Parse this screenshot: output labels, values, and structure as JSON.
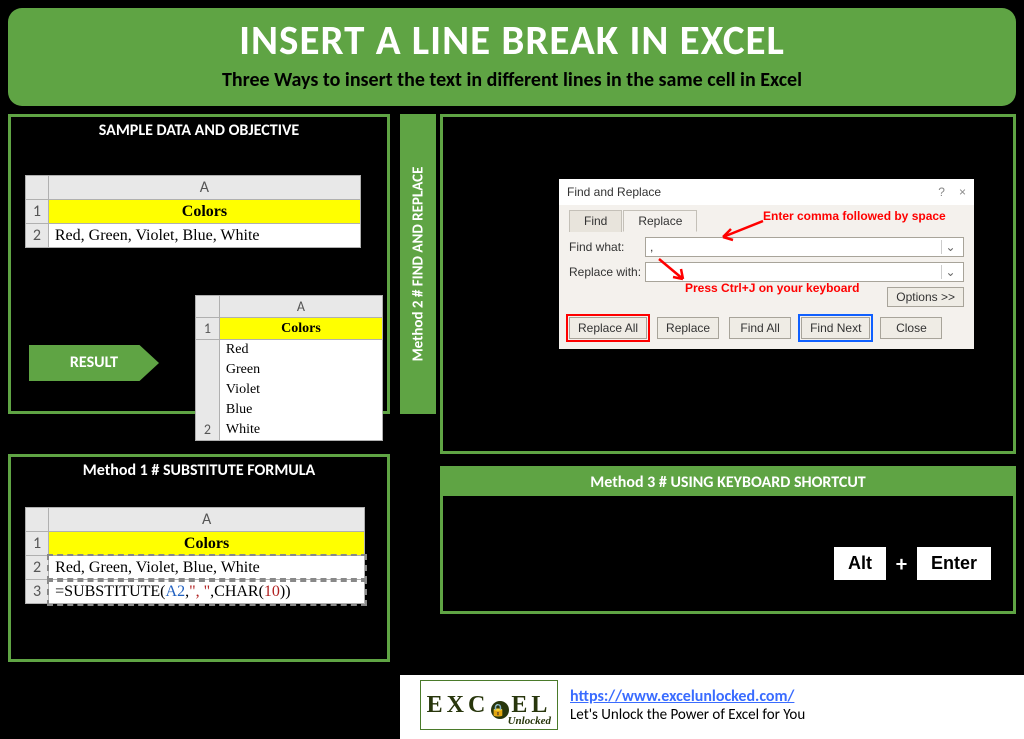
{
  "header": {
    "title": "INSERT A LINE BREAK IN EXCEL",
    "subtitle": "Three Ways to insert the text in different lines in the same cell in Excel"
  },
  "sample": {
    "title": "SAMPLE DATA AND OBJECTIVE",
    "grid1_colA": "A",
    "grid1_r1": "1",
    "grid1_r2": "2",
    "grid1_header": "Colors",
    "grid1_value": "Red, Green, Violet, Blue, White",
    "result_label": "RESULT",
    "grid2_colA": "A",
    "grid2_r1": "1",
    "grid2_r2": "2",
    "grid2_header": "Colors",
    "grid2_l1": "Red",
    "grid2_l2": "Green",
    "grid2_l3": "Violet",
    "grid2_l4": "Blue",
    "grid2_l5": "White"
  },
  "m1": {
    "title": "Method 1 # SUBSTITUTE FORMULA",
    "colA": "A",
    "r1": "1",
    "r2": "2",
    "r3": "3",
    "header": "Colors",
    "value": "Red, Green, Violet, Blue, White",
    "f_pre": "=SUBSTITUTE(",
    "f_ref": "A2",
    "f_c1": ",",
    "f_arg2": "\", \"",
    "f_c2": ",CHAR(",
    "f_num": "10",
    "f_post": "))"
  },
  "m2": {
    "vlabel": "Method 2 # FIND AND REPLACE",
    "dialog_title": "Find and Replace",
    "help": "?",
    "close": "×",
    "tab_find": "Find",
    "tab_replace": "Replace",
    "annot1": "Enter comma followed by space",
    "label_findwhat": "Find what:",
    "input_findwhat": ",",
    "label_replacewith": "Replace with:",
    "annot2": "Press Ctrl+J on your keyboard",
    "options": "Options >>",
    "btn_replaceall": "Replace All",
    "btn_replace": "Replace",
    "btn_findall": "Find All",
    "btn_findnext": "Find Next",
    "btn_close": "Close"
  },
  "m3": {
    "title": "Method 3 # USING KEYBOARD SHORTCUT",
    "key1": "Alt",
    "plus": "+",
    "key2": "Enter"
  },
  "footer": {
    "logo_big": "E XC E L",
    "logo_small": "Unlocked",
    "link": "https://www.excelunlocked.com/",
    "tagline": "Let's Unlock the Power of Excel for You"
  }
}
